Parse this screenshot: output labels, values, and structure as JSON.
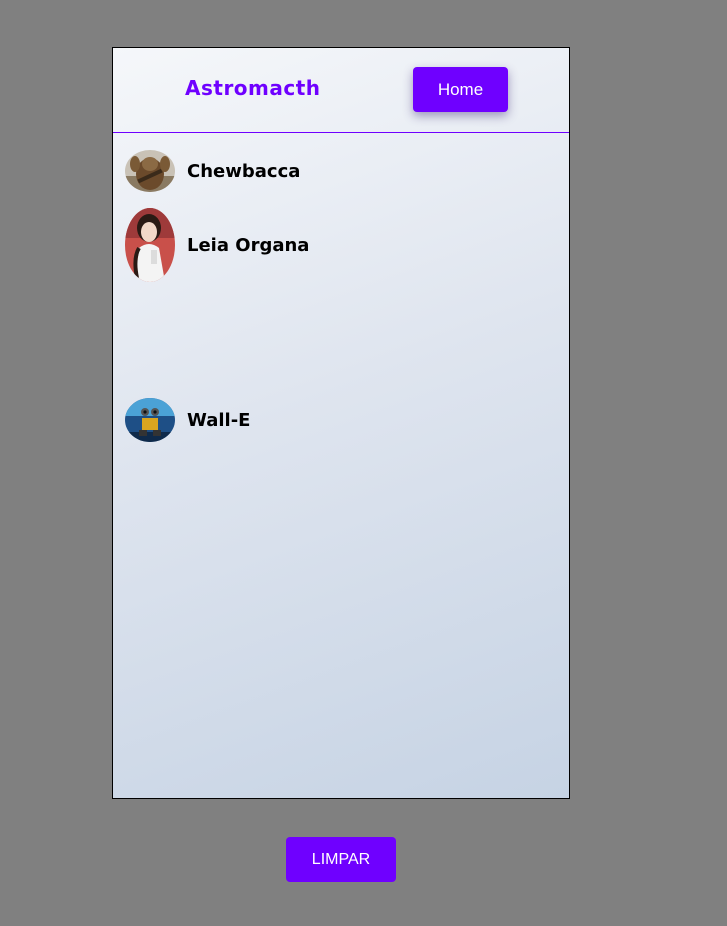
{
  "header": {
    "brand": "Astromacth",
    "home_label": "Home"
  },
  "characters": [
    {
      "name": "Chewbacca",
      "avatar": "chewbacca-avatar"
    },
    {
      "name": "Leia Organa",
      "avatar": "leia-avatar"
    },
    {
      "name": "Wall-E",
      "avatar": "wall-e-avatar"
    }
  ],
  "footer": {
    "clear_label": "LIMPAR"
  },
  "colors": {
    "accent": "#6f00ff",
    "page_background": "#808080"
  }
}
